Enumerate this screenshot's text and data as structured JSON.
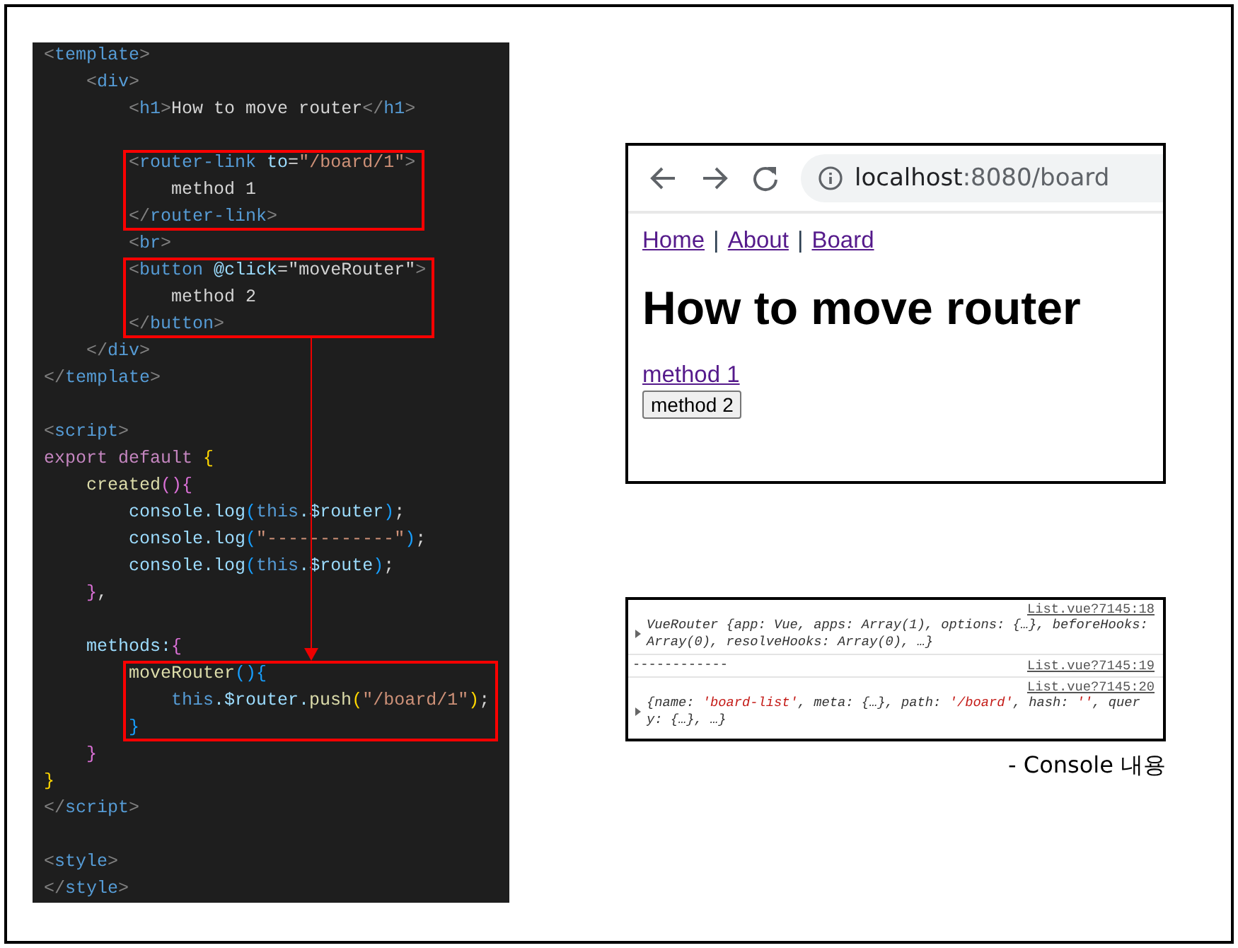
{
  "code": {
    "blocks": [
      {
        "boxed": false,
        "lines": [
          {
            "kind": "code",
            "tokens": [
              {
                "kind": "bracket",
                "text": "<"
              },
              {
                "kind": "tag",
                "text": "template"
              },
              {
                "kind": "bracket",
                "text": ">"
              }
            ]
          },
          {
            "kind": "code",
            "tokens": [
              {
                "kind": "bracket",
                "text": "    <"
              },
              {
                "kind": "tag",
                "text": "div"
              },
              {
                "kind": "bracket",
                "text": ">"
              }
            ]
          },
          {
            "kind": "code",
            "tokens": [
              {
                "kind": "bracket",
                "text": "        <"
              },
              {
                "kind": "tag",
                "text": "h1"
              },
              {
                "kind": "bracket",
                "text": ">"
              },
              {
                "kind": "text",
                "text": "How to move router"
              },
              {
                "kind": "bracket",
                "text": "</"
              },
              {
                "kind": "tag",
                "text": "h1"
              },
              {
                "kind": "bracket",
                "text": ">"
              }
            ]
          },
          {
            "kind": "blank"
          }
        ]
      },
      {
        "boxed": true,
        "lines": [
          {
            "kind": "code",
            "tokens": [
              {
                "kind": "bracket",
                "text": "        <"
              },
              {
                "kind": "tag",
                "text": "router-link "
              },
              {
                "kind": "attr",
                "text": "to"
              },
              {
                "kind": "text",
                "text": "="
              },
              {
                "kind": "string",
                "text": "\"/board/1\""
              },
              {
                "kind": "bracket",
                "text": ">"
              }
            ]
          },
          {
            "kind": "code",
            "tokens": [
              {
                "kind": "text",
                "text": "            method 1"
              }
            ]
          },
          {
            "kind": "code",
            "tokens": [
              {
                "kind": "bracket",
                "text": "        </"
              },
              {
                "kind": "tag",
                "text": "router-link"
              },
              {
                "kind": "bracket",
                "text": ">"
              }
            ]
          }
        ]
      },
      {
        "boxed": false,
        "lines": [
          {
            "kind": "code",
            "tokens": [
              {
                "kind": "bracket",
                "text": "        <"
              },
              {
                "kind": "tag",
                "text": "br"
              },
              {
                "kind": "bracket",
                "text": ">"
              }
            ]
          }
        ]
      },
      {
        "boxed": true,
        "lines": [
          {
            "kind": "code",
            "tokens": [
              {
                "kind": "bracket",
                "text": "        <"
              },
              {
                "kind": "tag",
                "text": "button "
              },
              {
                "kind": "attr",
                "text": "@click"
              },
              {
                "kind": "text",
                "text": "="
              },
              {
                "kind": "text",
                "text": "\"moveRouter\""
              },
              {
                "kind": "bracket",
                "text": ">"
              }
            ]
          },
          {
            "kind": "code",
            "tokens": [
              {
                "kind": "text",
                "text": "            method 2"
              }
            ]
          },
          {
            "kind": "code",
            "tokens": [
              {
                "kind": "bracket",
                "text": "        </"
              },
              {
                "kind": "tag",
                "text": "button"
              },
              {
                "kind": "bracket",
                "text": ">"
              }
            ]
          }
        ]
      },
      {
        "boxed": false,
        "lines": [
          {
            "kind": "code",
            "tokens": [
              {
                "kind": "bracket",
                "text": "    </"
              },
              {
                "kind": "tag",
                "text": "div"
              },
              {
                "kind": "bracket",
                "text": ">"
              }
            ]
          },
          {
            "kind": "code",
            "tokens": [
              {
                "kind": "bracket",
                "text": "</"
              },
              {
                "kind": "tag",
                "text": "template"
              },
              {
                "kind": "bracket",
                "text": ">"
              }
            ]
          },
          {
            "kind": "blank"
          },
          {
            "kind": "code",
            "tokens": [
              {
                "kind": "bracket",
                "text": "<"
              },
              {
                "kind": "tag",
                "text": "script"
              },
              {
                "kind": "bracket",
                "text": ">"
              }
            ]
          },
          {
            "kind": "code",
            "tokens": [
              {
                "kind": "keyword",
                "text": "export default "
              },
              {
                "kind": "brace1",
                "text": "{"
              }
            ]
          },
          {
            "kind": "code",
            "tokens": [
              {
                "kind": "func",
                "text": "    created"
              },
              {
                "kind": "brace2",
                "text": "(){"
              }
            ]
          },
          {
            "kind": "code",
            "tokens": [
              {
                "kind": "var",
                "text": "        console.log"
              },
              {
                "kind": "brace3",
                "text": "("
              },
              {
                "kind": "this",
                "text": "this"
              },
              {
                "kind": "var",
                "text": ".$router"
              },
              {
                "kind": "brace3",
                "text": ")"
              },
              {
                "kind": "text",
                "text": ";"
              }
            ]
          },
          {
            "kind": "code",
            "tokens": [
              {
                "kind": "var",
                "text": "        console.log"
              },
              {
                "kind": "brace3",
                "text": "("
              },
              {
                "kind": "string",
                "text": "\"------------\""
              },
              {
                "kind": "brace3",
                "text": ")"
              },
              {
                "kind": "text",
                "text": ";"
              }
            ]
          },
          {
            "kind": "code",
            "tokens": [
              {
                "kind": "var",
                "text": "        console.log"
              },
              {
                "kind": "brace3",
                "text": "("
              },
              {
                "kind": "this",
                "text": "this"
              },
              {
                "kind": "var",
                "text": ".$route"
              },
              {
                "kind": "brace3",
                "text": ")"
              },
              {
                "kind": "text",
                "text": ";"
              }
            ]
          },
          {
            "kind": "code",
            "tokens": [
              {
                "kind": "brace2",
                "text": "    }"
              },
              {
                "kind": "text",
                "text": ","
              }
            ]
          },
          {
            "kind": "blank"
          },
          {
            "kind": "code",
            "tokens": [
              {
                "kind": "var",
                "text": "    methods:"
              },
              {
                "kind": "brace2",
                "text": "{"
              }
            ]
          }
        ]
      },
      {
        "boxed": true,
        "lines": [
          {
            "kind": "code",
            "tokens": [
              {
                "kind": "func",
                "text": "        moveRouter"
              },
              {
                "kind": "brace3",
                "text": "(){"
              }
            ]
          },
          {
            "kind": "code",
            "tokens": [
              {
                "kind": "this",
                "text": "            this"
              },
              {
                "kind": "var",
                "text": ".$router."
              },
              {
                "kind": "func",
                "text": "push"
              },
              {
                "kind": "brace1",
                "text": "("
              },
              {
                "kind": "string",
                "text": "\"/board/1\""
              },
              {
                "kind": "brace1",
                "text": ")"
              },
              {
                "kind": "text",
                "text": ";"
              }
            ]
          },
          {
            "kind": "code",
            "tokens": [
              {
                "kind": "brace3",
                "text": "        }"
              }
            ]
          }
        ]
      },
      {
        "boxed": false,
        "lines": [
          {
            "kind": "code",
            "tokens": [
              {
                "kind": "brace2",
                "text": "    }"
              }
            ]
          },
          {
            "kind": "code",
            "tokens": [
              {
                "kind": "brace1",
                "text": "}"
              }
            ]
          },
          {
            "kind": "code",
            "tokens": [
              {
                "kind": "bracket",
                "text": "</"
              },
              {
                "kind": "tag",
                "text": "script"
              },
              {
                "kind": "bracket",
                "text": ">"
              }
            ]
          },
          {
            "kind": "blank"
          },
          {
            "kind": "code",
            "tokens": [
              {
                "kind": "bracket",
                "text": "<"
              },
              {
                "kind": "tag",
                "text": "style"
              },
              {
                "kind": "bracket",
                "text": ">"
              }
            ]
          },
          {
            "kind": "code",
            "tokens": [
              {
                "kind": "bracket",
                "text": "</"
              },
              {
                "kind": "tag",
                "text": "style"
              },
              {
                "kind": "bracket",
                "text": ">"
              }
            ]
          }
        ]
      }
    ]
  },
  "browser": {
    "url_host": "localhost",
    "url_path": ":8080/board",
    "nav": [
      {
        "label": "Home"
      },
      {
        "label": "About"
      },
      {
        "label": "Board"
      }
    ],
    "nav_separator": "|",
    "heading": "How to move router",
    "link": "method 1",
    "button": "method 2"
  },
  "console": {
    "entries": [
      {
        "source": "List.vue?7145:18",
        "expandable": true,
        "parts": [
          {
            "kind": "text",
            "text": "VueRouter {app: Vue, apps: Array(1), options: {…}, beforeHooks: Array(0), resolveHooks: Array(0), …}"
          }
        ]
      },
      {
        "source": "List.vue?7145:19",
        "expandable": false,
        "parts": [
          {
            "kind": "plain",
            "text": "------------"
          }
        ]
      },
      {
        "source": "List.vue?7145:20",
        "expandable": true,
        "parts": [
          {
            "kind": "text",
            "text": "{name: "
          },
          {
            "kind": "string",
            "text": "'board-list'"
          },
          {
            "kind": "text",
            "text": ", meta: {…}, path: "
          },
          {
            "kind": "string",
            "text": "'/board'"
          },
          {
            "kind": "text",
            "text": ", hash: "
          },
          {
            "kind": "string",
            "text": "''"
          },
          {
            "kind": "text",
            "text": ", query: {…}, …}"
          }
        ]
      }
    ],
    "caption": "- Console 내용"
  }
}
